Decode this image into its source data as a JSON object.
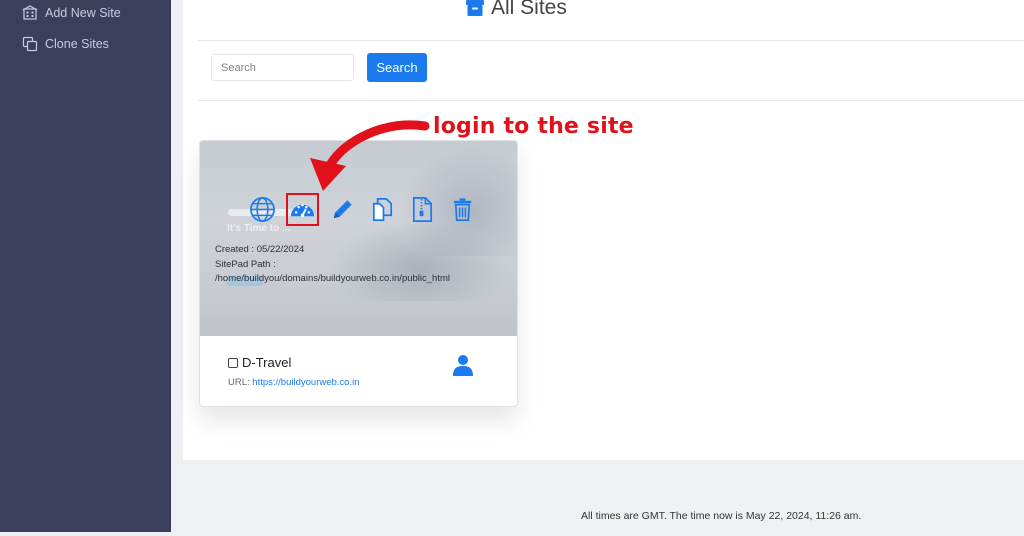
{
  "sidebar": {
    "items": [
      {
        "label": "Add New Site",
        "icon": "building-icon"
      },
      {
        "label": "Clone Sites",
        "icon": "clone-icon"
      }
    ]
  },
  "header": {
    "title": "All Sites",
    "icon": "archive-box-icon"
  },
  "search": {
    "placeholder": "Search",
    "button_label": "Search"
  },
  "annotation": {
    "text": "login to the site",
    "color": "#e0111b"
  },
  "card": {
    "created": "Created : 05/22/2024",
    "path_label": "SitePad Path :",
    "path": "/home/buildyou/domains/buildyourweb.co.in/public_html",
    "name": "D-Travel",
    "url_label": "URL:",
    "url": "https://buildyourweb.co.in",
    "actions": [
      "globe-icon",
      "dashboard-icon",
      "pencil-icon",
      "clone-icon",
      "zip-file-icon",
      "trash-icon"
    ],
    "thumb_ghost_text": "It's Time to ..."
  },
  "footer": {
    "text": "All times are GMT. The time now is May 22, 2024, 11:26 am."
  },
  "colors": {
    "accent": "#1a7bef",
    "sidebar": "#3b3f5c",
    "annotation": "#e0111b"
  }
}
